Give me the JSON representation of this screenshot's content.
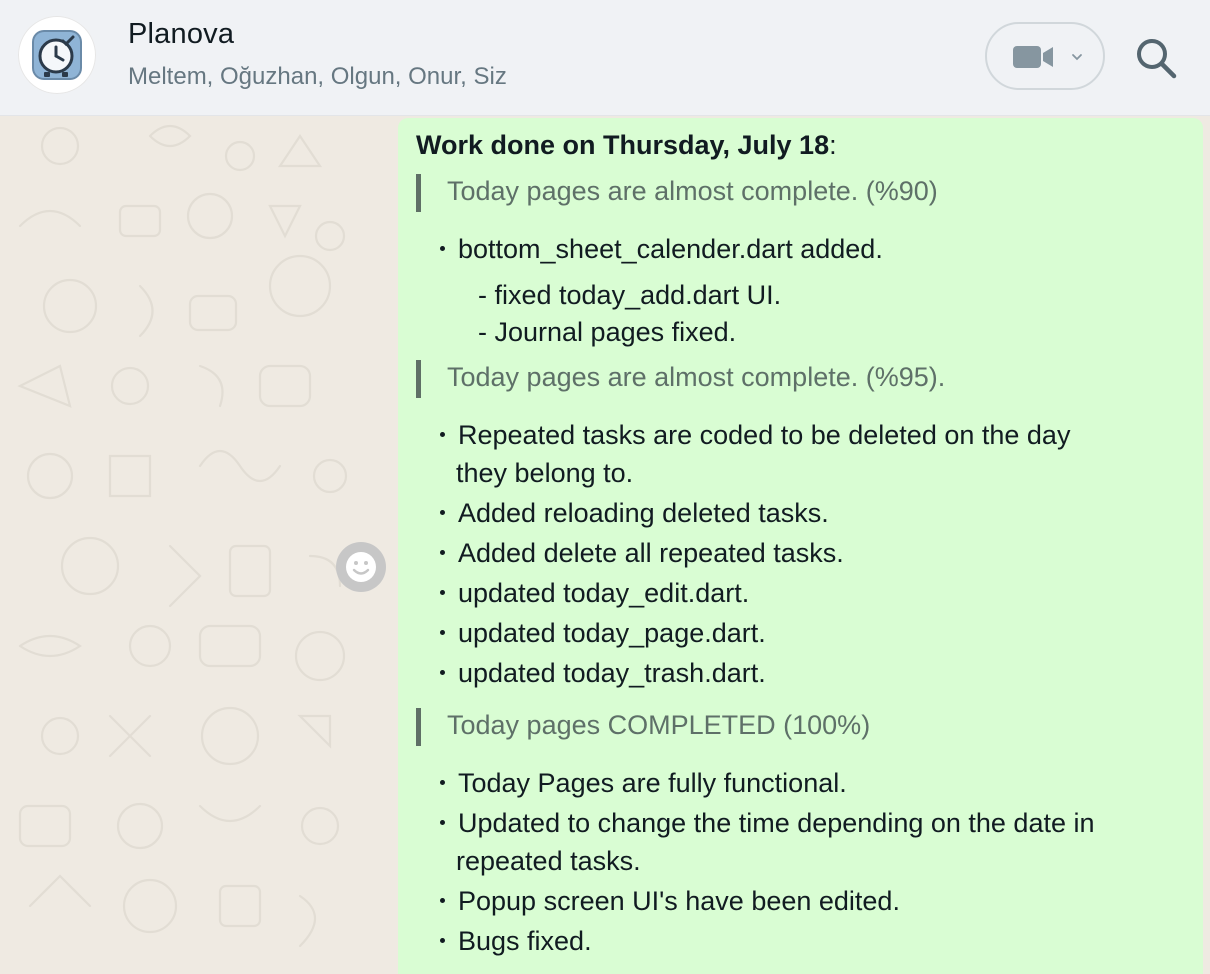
{
  "header": {
    "title": "Planova",
    "participants": "Meltem, Oğuzhan, Olgun, Onur, Siz",
    "avatar_icon": "clock-check-app-icon",
    "video_icon": "video-camera-icon",
    "search_icon": "search-icon"
  },
  "message": {
    "title_bold": "Work done on Thursday, July 18",
    "title_suffix": ":",
    "sections": [
      {
        "quote": "Today pages are almost complete. (%90)",
        "bullets": [
          "bottom_sheet_calender.dart added."
        ],
        "dash_items": [
          "- fixed today_add.dart UI.",
          "- Journal pages fixed."
        ]
      },
      {
        "quote": "Today pages are almost complete. (%95).",
        "bullets": [
          "Repeated tasks are coded to be deleted on the day",
          "they belong to.",
          "Added reloading deleted tasks.",
          "Added delete all repeated tasks.",
          "updated today_edit.dart.",
          "updated today_page.dart.",
          "updated today_trash.dart."
        ]
      },
      {
        "quote": "Today pages COMPLETED (100%)",
        "bullets": [
          "Today Pages are fully functional.",
          "Updated to change the time depending on the date in",
          "repeated tasks.",
          "Popup screen UI's have been edited.",
          "Bugs fixed."
        ]
      }
    ]
  },
  "colors": {
    "bubble": "#d9fdd3",
    "chat_bg": "#efeae2",
    "header_bg": "#f0f2f5",
    "quote_bar": "#5f6f66"
  }
}
